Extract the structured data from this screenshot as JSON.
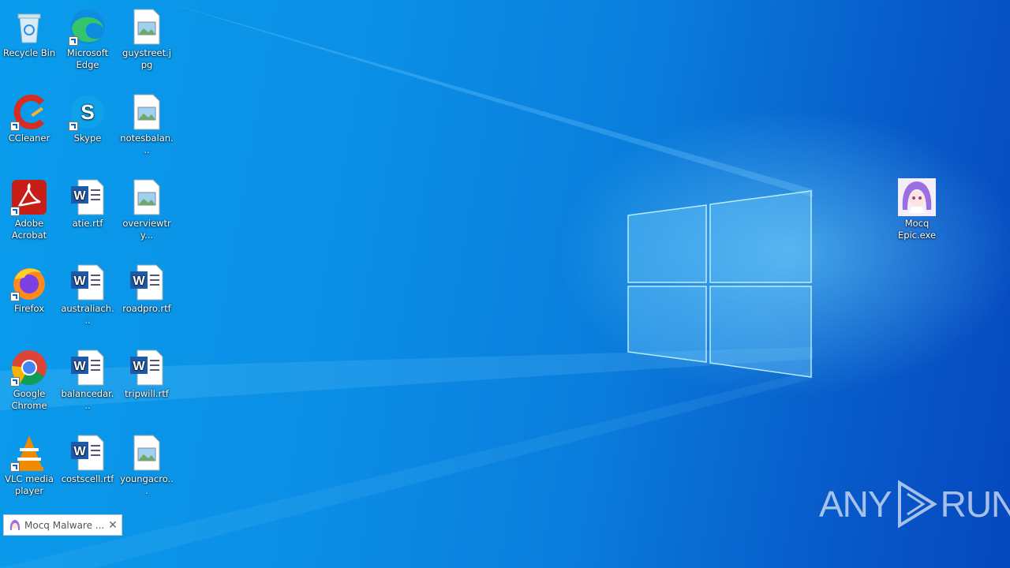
{
  "desktop": {
    "icons": [
      {
        "label": "Recycle Bin",
        "icon": "recycle-bin-icon"
      },
      {
        "label": "Microsoft Edge",
        "icon": "edge-icon"
      },
      {
        "label": "guystreet.jpg",
        "icon": "image-file-icon"
      },
      {
        "label": "CCleaner",
        "icon": "ccleaner-icon"
      },
      {
        "label": "Skype",
        "icon": "skype-icon"
      },
      {
        "label": "notesbalan...",
        "icon": "image-file-icon"
      },
      {
        "label": "Adobe Acrobat",
        "icon": "acrobat-icon"
      },
      {
        "label": "atie.rtf",
        "icon": "word-doc-icon"
      },
      {
        "label": "overviewtry...",
        "icon": "image-file-icon"
      },
      {
        "label": "Firefox",
        "icon": "firefox-icon"
      },
      {
        "label": "australiach...",
        "icon": "word-doc-icon"
      },
      {
        "label": "roadpro.rtf",
        "icon": "word-doc-icon"
      },
      {
        "label": "Google Chrome",
        "icon": "chrome-icon"
      },
      {
        "label": "balancedar...",
        "icon": "word-doc-icon"
      },
      {
        "label": "tripwill.rtf",
        "icon": "word-doc-icon"
      },
      {
        "label": "VLC media player",
        "icon": "vlc-icon"
      },
      {
        "label": "costscell.rtf",
        "icon": "word-doc-icon"
      },
      {
        "label": "youngacro...",
        "icon": "image-file-icon"
      },
      {
        "label": "Mocq Epic.exe",
        "icon": "anime-app-icon"
      }
    ]
  },
  "toast": {
    "title": "Mocq Malware ...",
    "close": "✕"
  },
  "watermark": {
    "text_left": "ANY",
    "text_right": "RUN"
  }
}
